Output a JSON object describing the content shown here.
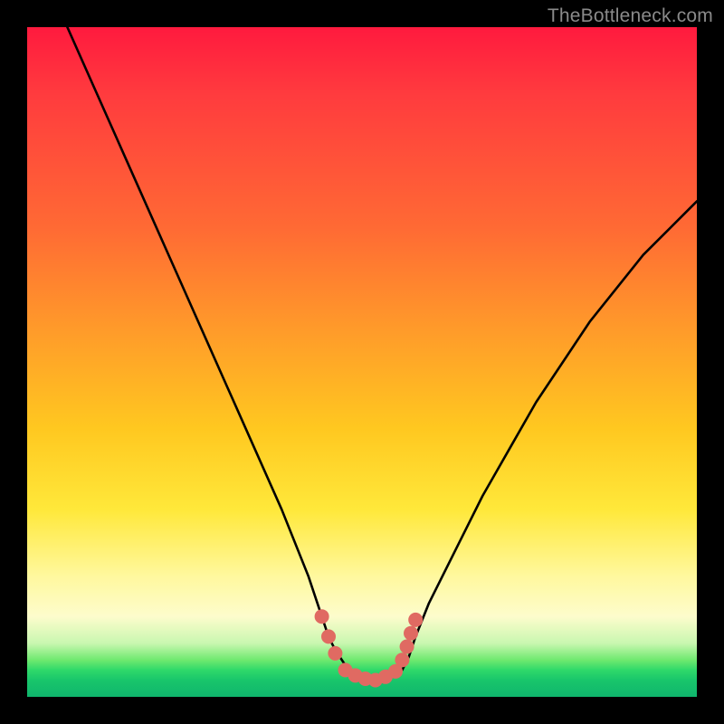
{
  "watermark": {
    "text": "TheBottleneck.com"
  },
  "chart_data": {
    "type": "line",
    "title": "",
    "xlabel": "",
    "ylabel": "",
    "xlim": [
      0,
      100
    ],
    "ylim": [
      0,
      100
    ],
    "grid": false,
    "series": [
      {
        "name": "curve",
        "x": [
          6,
          10,
          14,
          18,
          22,
          26,
          30,
          34,
          38,
          42,
          44,
          45,
          46,
          48,
          52,
          56,
          57,
          58,
          60,
          64,
          68,
          72,
          76,
          80,
          84,
          88,
          92,
          96,
          100
        ],
        "values": [
          100,
          91,
          82,
          73,
          64,
          55,
          46,
          37,
          28,
          18,
          12,
          9,
          7,
          4,
          2.5,
          4,
          6,
          9,
          14,
          22,
          30,
          37,
          44,
          50,
          56,
          61,
          66,
          70,
          74
        ]
      }
    ],
    "markers": {
      "name": "highlighted-region",
      "color": "#e06a62",
      "points": [
        {
          "x": 44.0,
          "y": 12.0
        },
        {
          "x": 45.0,
          "y": 9.0
        },
        {
          "x": 46.0,
          "y": 6.5
        },
        {
          "x": 47.5,
          "y": 4.0
        },
        {
          "x": 49.0,
          "y": 3.2
        },
        {
          "x": 50.5,
          "y": 2.7
        },
        {
          "x": 52.0,
          "y": 2.5
        },
        {
          "x": 53.5,
          "y": 3.0
        },
        {
          "x": 55.0,
          "y": 3.8
        },
        {
          "x": 56.0,
          "y": 5.5
        },
        {
          "x": 56.7,
          "y": 7.5
        },
        {
          "x": 57.3,
          "y": 9.5
        },
        {
          "x": 58.0,
          "y": 11.5
        }
      ]
    },
    "background_gradient": {
      "top_color": "#ff1a3e",
      "mid_color": "#ffe83a",
      "bottom_color": "#0fb56c"
    }
  }
}
